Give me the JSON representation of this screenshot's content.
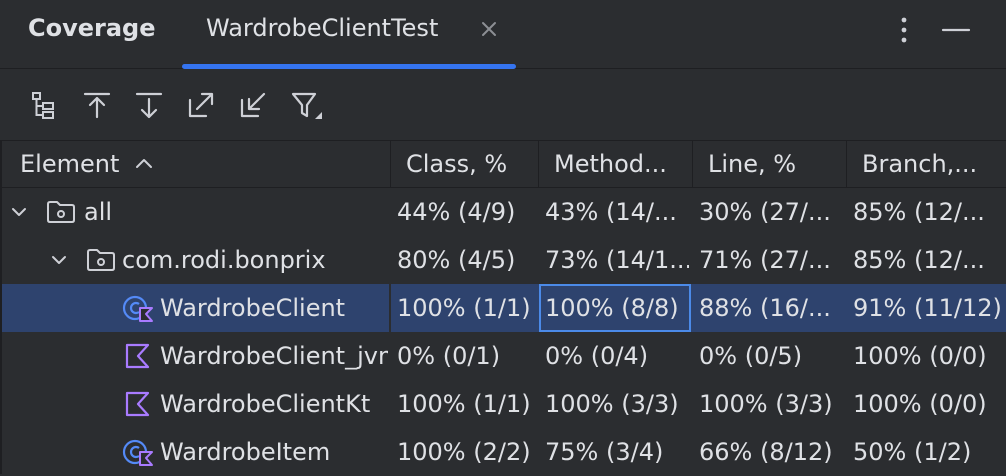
{
  "panel": {
    "title": "Coverage",
    "active_tab": "WardrobeClientTest",
    "close_icon": "close-icon",
    "menu_icon": "more-vertical-icon",
    "minimize_icon": "minimize-icon"
  },
  "toolbar": {
    "tools": [
      {
        "name": "flatten-packages",
        "icon": "hierarchy-icon"
      },
      {
        "name": "navigate-up",
        "icon": "arrow-up-icon"
      },
      {
        "name": "navigate-down",
        "icon": "arrow-down-icon"
      },
      {
        "name": "expand",
        "icon": "expand-icon"
      },
      {
        "name": "collapse",
        "icon": "collapse-icon"
      },
      {
        "name": "filter",
        "icon": "filter-icon"
      }
    ]
  },
  "table": {
    "columns": [
      "Element",
      "Class, %",
      "Method...",
      "Line, %",
      "Branch,..."
    ],
    "sort_indicator": "ascending",
    "rows": [
      {
        "element": "all",
        "class": "44% (4/9)",
        "method": "43% (14/...",
        "line": "30% (27/...",
        "branch": "85% (12/...",
        "icon": "folder-icon"
      },
      {
        "element": "com.rodi.bonprix",
        "class": "80% (4/5)",
        "method": "73% (14/1...",
        "line": "71% (27/...",
        "branch": "85% (12/...",
        "icon": "package-icon"
      },
      {
        "element": "WardrobeClient",
        "class": "100% (1/1)",
        "method": "100% (8/8)",
        "line": "88% (16/...",
        "branch": "91% (11/12)",
        "icon": "kotlin-class-icon",
        "selected": true
      },
      {
        "element": "WardrobeClient_jvm",
        "class": "0% (0/1)",
        "method": "0% (0/4)",
        "line": "0% (0/5)",
        "branch": "100% (0/0)",
        "icon": "kotlin-file-icon"
      },
      {
        "element": "WardrobeClientKt",
        "class": "100% (1/1)",
        "method": "100% (3/3)",
        "line": "100% (3/3)",
        "branch": "100% (0/0)",
        "icon": "kotlin-file-icon"
      },
      {
        "element": "WardrobeItem",
        "class": "100% (2/2)",
        "method": "75% (3/4)",
        "line": "66% (8/12)",
        "branch": "50% (1/2)",
        "icon": "kotlin-class-icon"
      }
    ]
  },
  "colors": {
    "background": "#2b2d30",
    "selection": "#2e436e",
    "accent": "#3574f0",
    "focus": "#4b8ae8",
    "kotlin": "#a97bff",
    "icon": "#ced0d6"
  }
}
